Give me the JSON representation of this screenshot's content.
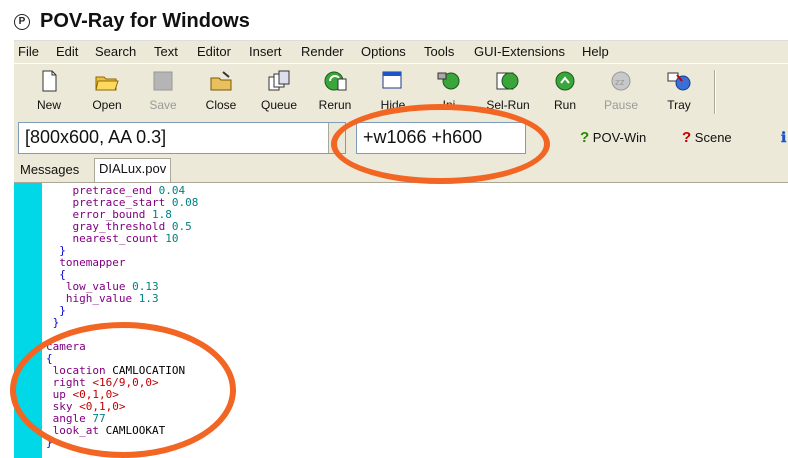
{
  "window": {
    "title": "POV-Ray for Windows",
    "icon": "povray-icon"
  },
  "menu": [
    "File",
    "Edit",
    "Search",
    "Text",
    "Editor",
    "Insert",
    "Render",
    "Options",
    "Tools",
    "GUI-Extensions",
    "Help"
  ],
  "toolbar": [
    {
      "label": "New",
      "icon": "new-file-icon",
      "enabled": true
    },
    {
      "label": "Open",
      "icon": "open-folder-icon",
      "enabled": true
    },
    {
      "label": "Save",
      "icon": "save-icon",
      "enabled": false
    },
    {
      "label": "Close",
      "icon": "close-file-icon",
      "enabled": true
    },
    {
      "label": "Queue",
      "icon": "queue-icon",
      "enabled": true
    },
    {
      "label": "Rerun",
      "icon": "rerun-icon",
      "enabled": true
    },
    {
      "label": "Hide",
      "icon": "hide-icon",
      "enabled": true
    },
    {
      "label": "Ini",
      "icon": "ini-icon",
      "enabled": true
    },
    {
      "label": "Sel-Run",
      "icon": "sel-run-icon",
      "enabled": true
    },
    {
      "label": "Run",
      "icon": "run-icon",
      "enabled": true
    },
    {
      "label": "Pause",
      "icon": "pause-icon",
      "enabled": false
    },
    {
      "label": "Tray",
      "icon": "tray-icon",
      "enabled": true
    }
  ],
  "render_settings": {
    "selected": "[800x600, AA 0.3]"
  },
  "command_line": {
    "value": "+w1066 +h600"
  },
  "help_links": [
    {
      "label": "POV-Win",
      "icon": "help-question-icon",
      "color": "#2a8a00"
    },
    {
      "label": "Scene",
      "icon": "help-question-icon",
      "color": "#c00000"
    }
  ],
  "tabs": [
    {
      "label": "Messages",
      "active": false
    },
    {
      "label": "DIALux.pov",
      "active": true
    }
  ],
  "code": {
    "lines": [
      {
        "indent": "    ",
        "kw": "pretrace_end",
        "val": "0.04"
      },
      {
        "indent": "    ",
        "kw": "pretrace_start",
        "val": "0.08"
      },
      {
        "indent": "    ",
        "kw": "error_bound",
        "val": "1.8"
      },
      {
        "indent": "    ",
        "kw": "gray_threshold",
        "val": "0.5"
      },
      {
        "indent": "    ",
        "kw": "nearest_count",
        "val": "10"
      },
      {
        "indent": "  ",
        "kw": "}",
        "val": ""
      },
      {
        "indent": "  ",
        "kw": "tonemapper",
        "val": ""
      },
      {
        "indent": "  ",
        "kw": "{",
        "val": ""
      },
      {
        "indent": "   ",
        "kw": "low_value",
        "val": "0.13"
      },
      {
        "indent": "   ",
        "kw": "high_value",
        "val": "1.3"
      },
      {
        "indent": "  ",
        "kw": "}",
        "val": ""
      },
      {
        "indent": " ",
        "kw": "}",
        "val": ""
      },
      {
        "indent": "",
        "kw": "",
        "val": ""
      },
      {
        "indent": "",
        "kw": "camera",
        "val": ""
      },
      {
        "indent": "",
        "kw": "{",
        "val": ""
      },
      {
        "indent": " ",
        "kw": "location",
        "val": "CAMLOCATION"
      },
      {
        "indent": " ",
        "kw": "right",
        "val": "<16/9,0,0>"
      },
      {
        "indent": " ",
        "kw": "up",
        "val": "<0,1,0>"
      },
      {
        "indent": " ",
        "kw": "sky",
        "val": "<0,1,0>"
      },
      {
        "indent": " ",
        "kw": "angle",
        "val": "77"
      },
      {
        "indent": " ",
        "kw": "look_at",
        "val": "CAMLOOKAT"
      },
      {
        "indent": "",
        "kw": "}",
        "val": ""
      }
    ]
  },
  "colors": {
    "annotation": "#f26522",
    "gutter": "#00d8e8",
    "toolbar_bg": "#ece9d8"
  }
}
